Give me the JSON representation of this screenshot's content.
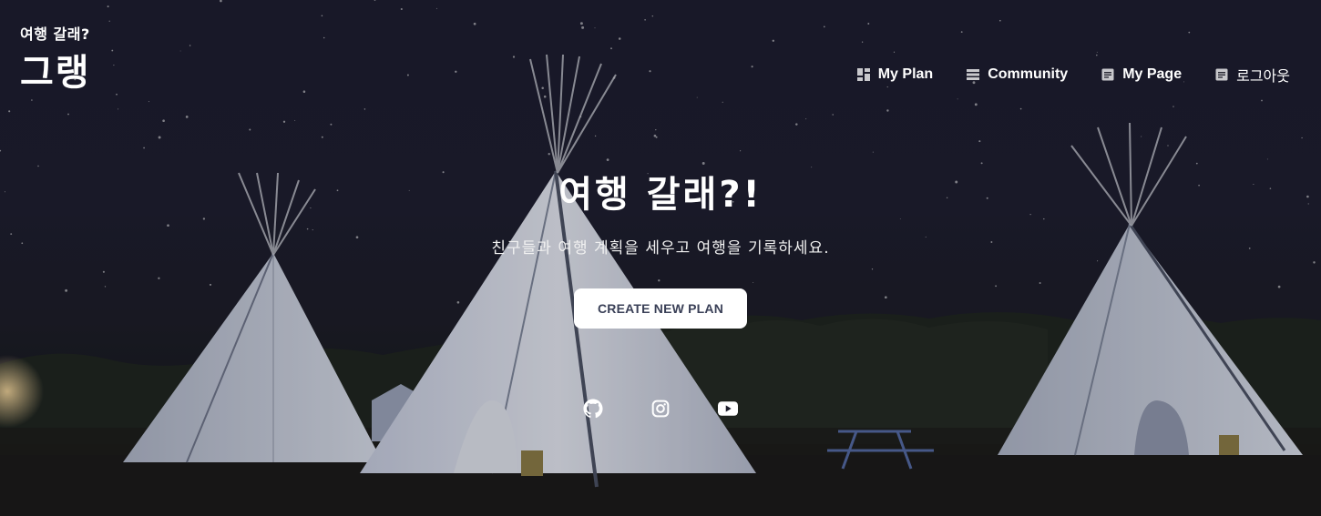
{
  "brand": {
    "subtitle": "여행 갈래?",
    "name": "그랭"
  },
  "nav": {
    "items": [
      {
        "label": "My Plan",
        "icon": "dashboard-icon"
      },
      {
        "label": "Community",
        "icon": "list-icon"
      },
      {
        "label": "My Page",
        "icon": "document-icon"
      },
      {
        "label": "로그아웃",
        "icon": "document-icon"
      }
    ]
  },
  "hero": {
    "title": "여행 갈래?!",
    "subtitle": "친구들과 여행 계획을 세우고 여행을 기록하세요.",
    "cta_label": "CREATE NEW PLAN"
  },
  "social": {
    "items": [
      {
        "icon": "github-icon"
      },
      {
        "icon": "instagram-icon"
      },
      {
        "icon": "youtube-icon"
      }
    ]
  },
  "colors": {
    "sky": "#1d1d2c",
    "tent": "#c9cfdc",
    "cta_text": "#3a4057",
    "cta_bg": "#ffffff"
  }
}
